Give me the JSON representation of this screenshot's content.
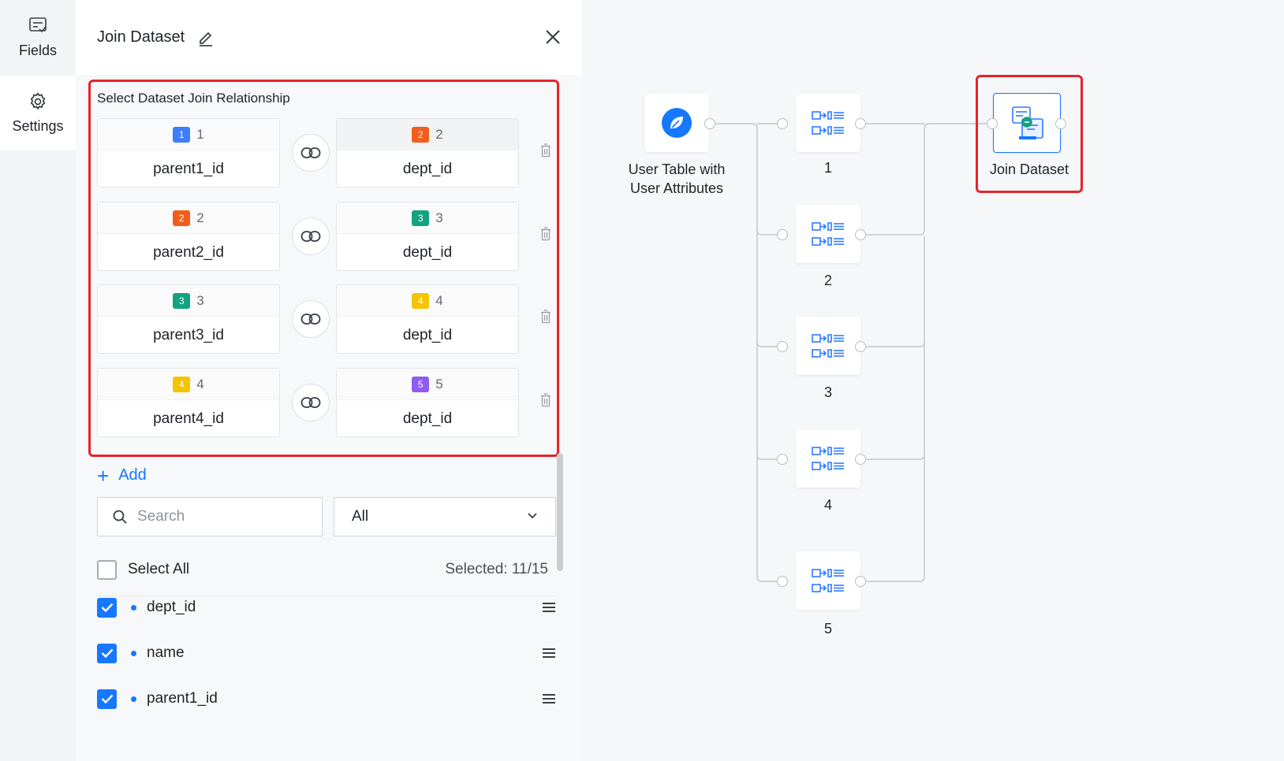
{
  "rail": {
    "items": [
      {
        "label": "Fields",
        "icon": "fields-icon"
      },
      {
        "label": "Settings",
        "icon": "gear-icon"
      }
    ]
  },
  "panel": {
    "title": "Join Dataset",
    "relationship_title": "Select Dataset Join Relationship",
    "relations": [
      {
        "left": {
          "badge": "1",
          "num": "1",
          "field": "parent1_id",
          "color": "#3d7eff"
        },
        "right": {
          "badge": "2",
          "num": "2",
          "field": "dept_id",
          "color": "#f25d1c"
        }
      },
      {
        "left": {
          "badge": "2",
          "num": "2",
          "field": "parent2_id",
          "color": "#f25d1c"
        },
        "right": {
          "badge": "3",
          "num": "3",
          "field": "dept_id",
          "color": "#14a37f"
        }
      },
      {
        "left": {
          "badge": "3",
          "num": "3",
          "field": "parent3_id",
          "color": "#14a37f"
        },
        "right": {
          "badge": "4",
          "num": "4",
          "field": "dept_id",
          "color": "#f5c400"
        }
      },
      {
        "left": {
          "badge": "4",
          "num": "4",
          "field": "parent4_id",
          "color": "#f5c400"
        },
        "right": {
          "badge": "5",
          "num": "5",
          "field": "dept_id",
          "color": "#8e5cf0"
        }
      }
    ],
    "add_label": "Add",
    "search_placeholder": "Search",
    "filter_value": "All",
    "select_all_label": "Select All",
    "selected_count": "Selected: 11/15",
    "fields": [
      {
        "name": "dept_id",
        "checked": true
      },
      {
        "name": "name",
        "checked": true
      },
      {
        "name": "parent1_id",
        "checked": true
      }
    ]
  },
  "canvas": {
    "source_node": {
      "label_line1": "User Table with",
      "label_line2": "User Attributes"
    },
    "dataset_nodes": [
      "1",
      "2",
      "3",
      "4",
      "5"
    ],
    "join_node": {
      "label": "Join Dataset"
    }
  },
  "colors": {
    "accent": "#1677ff",
    "highlight": "#e8232b"
  }
}
